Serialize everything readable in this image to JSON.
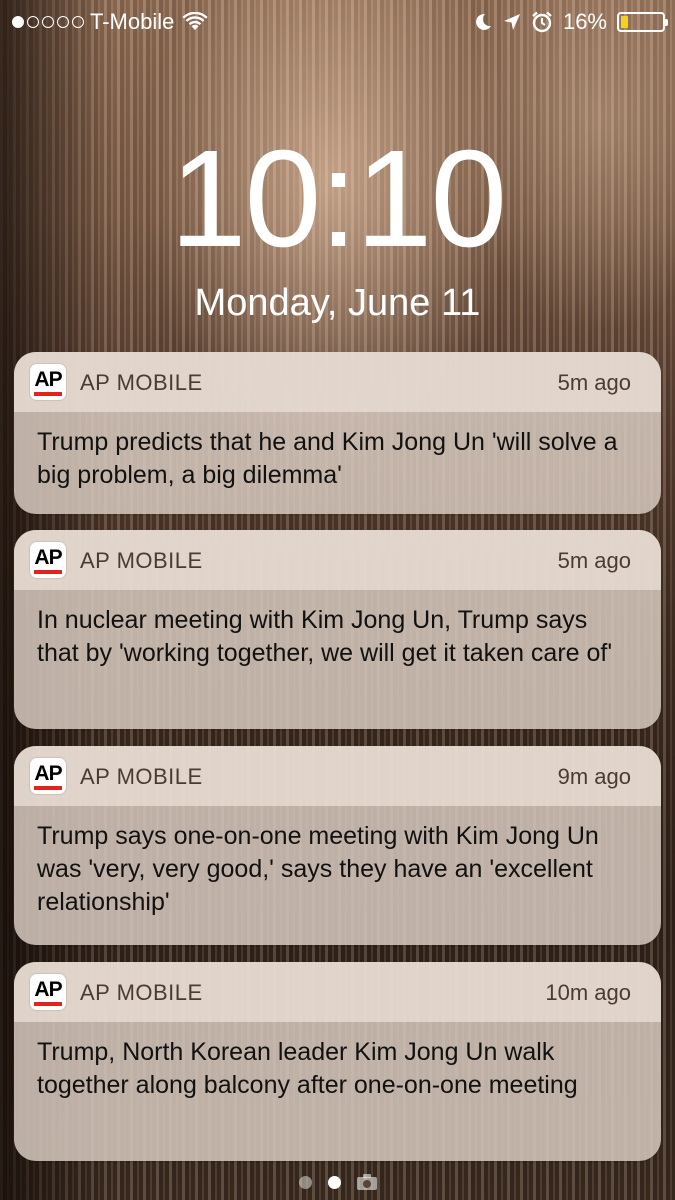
{
  "status_bar": {
    "carrier": "T-Mobile",
    "battery_percent": "16%",
    "battery_level": 0.16,
    "battery_color": "#f5d11a",
    "signal_bars_filled": 1,
    "signal_bars_total": 5,
    "icons": [
      "wifi-icon",
      "moon-icon",
      "location-arrow-icon",
      "alarm-icon",
      "battery-icon"
    ]
  },
  "lockscreen": {
    "time": "10:10",
    "date": "Monday, June 11"
  },
  "notifications": [
    {
      "app": "AP MOBILE",
      "app_icon": "ap-logo-icon",
      "ago": "5m ago",
      "text": "Trump predicts that he and Kim Jong Un 'will solve a big problem, a big dilemma'"
    },
    {
      "app": "AP MOBILE",
      "app_icon": "ap-logo-icon",
      "ago": "5m ago",
      "text": "In nuclear meeting with Kim Jong Un, Trump says that by 'working together, we will get it taken care of'"
    },
    {
      "app": "AP MOBILE",
      "app_icon": "ap-logo-icon",
      "ago": "9m ago",
      "text": "Trump says one-on-one meeting with Kim Jong Un was 'very, very good,' says they have an 'excellent relationship'"
    },
    {
      "app": "AP MOBILE",
      "app_icon": "ap-logo-icon",
      "ago": "10m ago",
      "text": "Trump, North Korean leader Kim Jong Un walk together along balcony after one-on-one meeting"
    }
  ],
  "pager": {
    "pages": 2,
    "active_page": 2,
    "trailing_icon": "camera-icon"
  },
  "colors": {
    "ap_red": "#e2231a"
  }
}
